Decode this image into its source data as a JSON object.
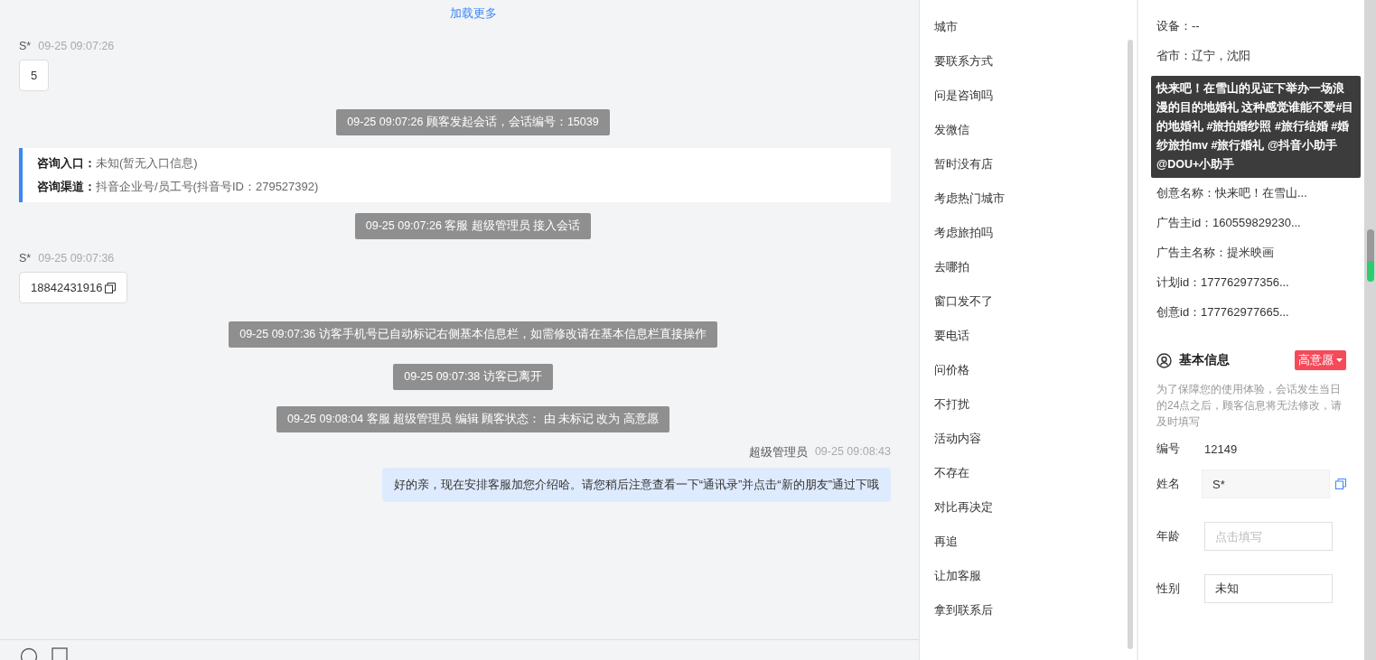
{
  "chat": {
    "load_more": "加载更多",
    "messages": [
      {
        "kind": "visitor",
        "name": "S*",
        "time": "09-25 09:07:26",
        "text": "5",
        "copyable": false
      },
      {
        "kind": "system",
        "text": "09-25 09:07:26 顾客发起会话，会话编号：15039"
      },
      {
        "kind": "entry",
        "rows": [
          {
            "label": "咨询入口：",
            "value": "未知(暂无入口信息)"
          },
          {
            "label": "咨询渠道：",
            "value": "抖音企业号/员工号(抖音号ID：279527392)"
          }
        ]
      },
      {
        "kind": "system",
        "text": "09-25 09:07:26 客服 超级管理员 接入会话"
      },
      {
        "kind": "visitor",
        "name": "S*",
        "time": "09-25 09:07:36",
        "text": "18842431916",
        "copyable": true
      },
      {
        "kind": "system",
        "text": "09-25 09:07:36 访客手机号已自动标记右侧基本信息栏，如需修改请在基本信息栏直接操作"
      },
      {
        "kind": "system",
        "text": "09-25 09:07:38 访客已离开"
      },
      {
        "kind": "system",
        "text": "09-25 09:08:04 客服 超级管理员 编辑 顾客状态： 由 未标记 改为 高意愿"
      },
      {
        "kind": "agent",
        "name": "超级管理员",
        "time": "09-25 09:08:43",
        "text": "好的亲，现在安排客服加您介绍哈。请您稍后注意查看一下“通讯录”并点击“新的朋友”通过下哦"
      }
    ]
  },
  "quick_replies": [
    "城市",
    "要联系方式",
    "问是咨询吗",
    "发微信",
    "暂时没有店",
    "考虑热门城市",
    "考虑旅拍吗",
    "去哪拍",
    "窗口发不了",
    "要电话",
    "问价格",
    "不打扰",
    "活动内容",
    "不存在",
    "对比再决定",
    "再追",
    "让加客服",
    "拿到联系后"
  ],
  "source_info": {
    "rows_above": [
      "设备：--",
      "省市：辽宁，沈阳"
    ],
    "tooltip": "快来吧！在雪山的见证下举办一场浪漫的目的地婚礼 这种感觉谁能不爱#目的地婚礼 #旅拍婚纱照 #旅行结婚 #婚纱旅拍mv #旅行婚礼 @抖音小助手 @DOU+小助手",
    "rows_below": [
      "创意名称：快来吧！在雪山...",
      "广告主id：160559829230...",
      "广告主名称：提米映画",
      "计划id：177762977356...",
      "创意id：177762977665..."
    ]
  },
  "basic_info": {
    "title": "基本信息",
    "tag": "高意愿",
    "notice": "为了保障您的使用体验，会话发生当日的24点之后，顾客信息将无法修改，请及时填写",
    "fields": [
      {
        "kind": "text",
        "label": "编号",
        "value": "12149"
      },
      {
        "kind": "input",
        "label": "姓名",
        "value": "S*",
        "disabled": true,
        "copyable": true
      },
      {
        "kind": "input",
        "label": "年龄",
        "placeholder": "点击填写",
        "disabled": false,
        "copyable": false
      },
      {
        "kind": "input",
        "label": "性别",
        "value": "未知",
        "disabled": false,
        "copyable": false
      }
    ]
  }
}
